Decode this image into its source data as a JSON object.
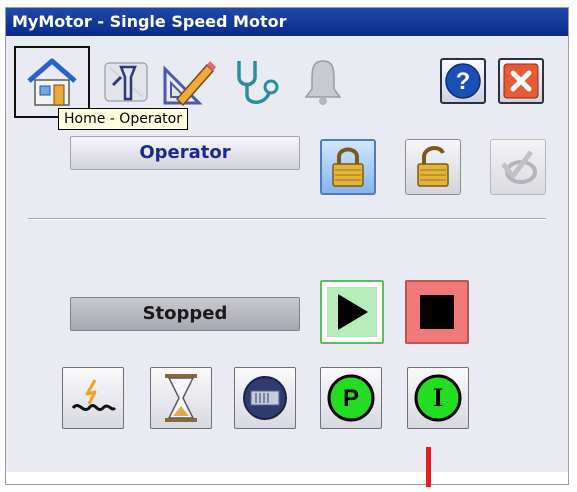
{
  "window": {
    "title": "MyMotor - Single Speed Motor"
  },
  "toolbar": {
    "tabs": [
      {
        "name": "home-tab",
        "icon": "home-icon",
        "tooltip": "Home - Operator"
      },
      {
        "name": "maintenance-tab",
        "icon": "maintenance-tools-icon"
      },
      {
        "name": "engineering-tab",
        "icon": "engineering-pencil-icon"
      },
      {
        "name": "diagnostics-tab",
        "icon": "stethoscope-icon"
      },
      {
        "name": "alarms-tab",
        "icon": "bell-icon"
      }
    ],
    "help_icon": "help-icon",
    "close_icon": "close-icon"
  },
  "control": {
    "mode_label": "Operator",
    "lock_icon": "locked-padlock-icon",
    "unlock_icon": "unlocked-padlock-icon",
    "ack_icon": "acknowledge-icon"
  },
  "status": {
    "state_label": "Stopped",
    "start_icon": "play-icon",
    "stop_icon": "stop-icon"
  },
  "indicators": [
    {
      "name": "interlock-button",
      "icon": "interlock-icon"
    },
    {
      "name": "timer-button",
      "icon": "hourglass-icon"
    },
    {
      "name": "feedback-button",
      "icon": "feedback-icon"
    },
    {
      "name": "permissive-button",
      "icon": "permissive-icon",
      "text": "P"
    },
    {
      "name": "interlock-i-button",
      "icon": "interlock-i-icon",
      "text": "I"
    }
  ],
  "colors": {
    "titlebar": "#0a2a8a",
    "start_green": "#b8ecb8",
    "stop_red": "#f07a7a",
    "indicator_green": "#22dd22",
    "panel": "#eaeaf2"
  }
}
